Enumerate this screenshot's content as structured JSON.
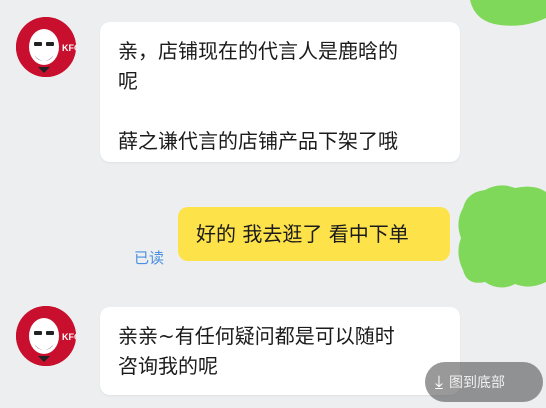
{
  "chat": {
    "messages": [
      {
        "sender": "KFC",
        "direction": "in",
        "text": "亲，店铺现在的代言人是鹿晗的\n呢\n\n薛之谦代言的店铺产品下架了哦"
      },
      {
        "sender": "me",
        "direction": "out",
        "text": "好的  我去逛了  看中下单",
        "status": "已读"
      },
      {
        "sender": "KFC",
        "direction": "in",
        "text": "亲亲~有任何疑问都是可以随时\n咨询我的呢"
      }
    ]
  },
  "avatar": {
    "brand_text": "KFC",
    "brand_color": "#c8102e"
  },
  "watermark": {
    "text": "图到底部"
  },
  "colors": {
    "background": "#eceef0",
    "incoming": "#ffffff",
    "outgoing": "#fde24a",
    "read": "#4a90e2",
    "blob": "#7fd85a"
  }
}
